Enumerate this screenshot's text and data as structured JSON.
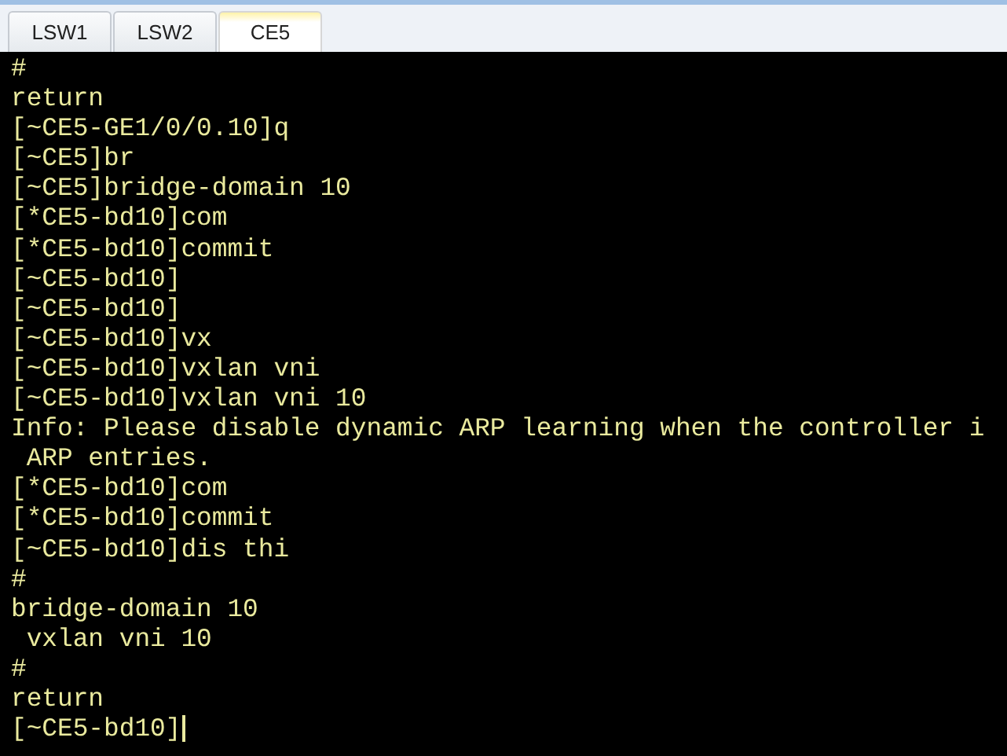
{
  "tabs": [
    {
      "label": "LSW1",
      "selected": false
    },
    {
      "label": "LSW2",
      "selected": false
    },
    {
      "label": "CE5",
      "selected": true
    }
  ],
  "terminal": {
    "cursor": true,
    "lines": [
      "#",
      "return",
      "[~CE5-GE1/0/0.10]q",
      "[~CE5]br",
      "[~CE5]bridge-domain 10",
      "[*CE5-bd10]com",
      "[*CE5-bd10]commit",
      "[~CE5-bd10]",
      "[~CE5-bd10]",
      "[~CE5-bd10]vx",
      "[~CE5-bd10]vxlan vni",
      "[~CE5-bd10]vxlan vni 10",
      "Info: Please disable dynamic ARP learning when the controller i",
      " ARP entries.",
      "[*CE5-bd10]com",
      "[*CE5-bd10]commit",
      "[~CE5-bd10]dis thi",
      "#",
      "bridge-domain 10",
      " vxlan vni 10",
      "#",
      "return",
      "[~CE5-bd10]"
    ]
  }
}
